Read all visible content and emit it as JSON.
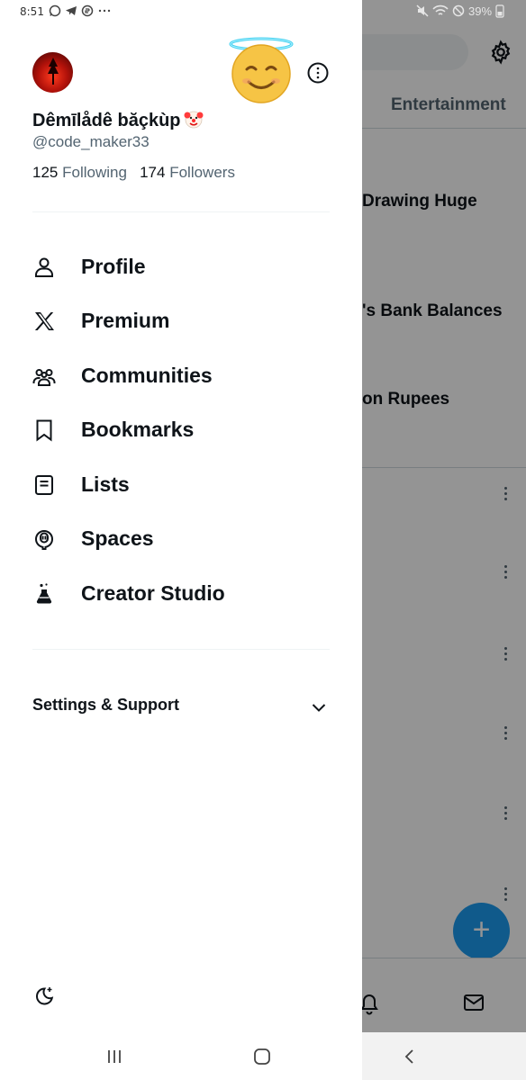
{
  "status_bar": {
    "time": "8:51",
    "battery": "39%",
    "app_icons": [
      "whatsapp-icon",
      "telegram-icon",
      "whatsapp-business-icon",
      "more-dots"
    ]
  },
  "background": {
    "tab_label": "Entertainment",
    "trend_1": "Drawing Huge",
    "trend_2": "'s Bank Balances",
    "trend_3": "on Rupees",
    "fab_label": "+"
  },
  "profile": {
    "display_name": "Dêmīlådê băçkùp",
    "handle": "@code_maker33",
    "following_count": "125",
    "following_label": "Following",
    "followers_count": "174",
    "followers_label": "Followers"
  },
  "menu": {
    "items": [
      {
        "label": "Profile",
        "icon": "person-icon"
      },
      {
        "label": "Premium",
        "icon": "x-logo-icon"
      },
      {
        "label": "Communities",
        "icon": "communities-icon"
      },
      {
        "label": "Bookmarks",
        "icon": "bookmark-icon"
      },
      {
        "label": "Lists",
        "icon": "list-icon"
      },
      {
        "label": "Spaces",
        "icon": "spaces-mic-icon"
      },
      {
        "label": "Creator Studio",
        "icon": "flask-icon"
      }
    ]
  },
  "settings": {
    "label": "Settings & Support"
  },
  "colors": {
    "text_primary": "#0f1419",
    "text_secondary": "#536471",
    "accent": "#1d9bf0",
    "divider": "#eff3f4"
  }
}
